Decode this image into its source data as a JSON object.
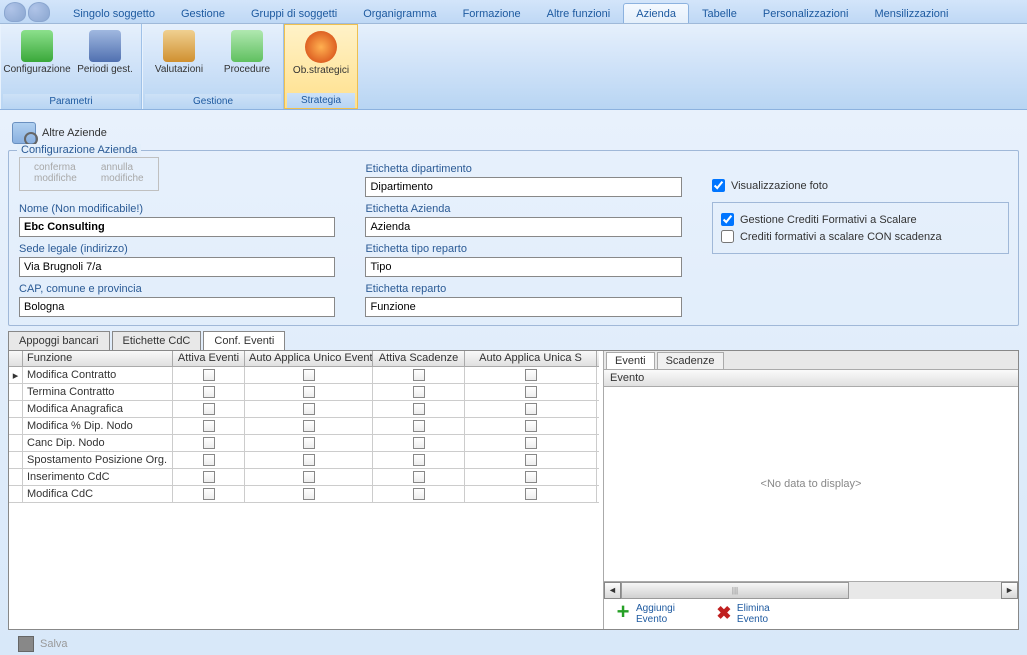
{
  "topTabs": {
    "items": [
      {
        "label": "Singolo soggetto"
      },
      {
        "label": "Gestione"
      },
      {
        "label": "Gruppi di soggetti"
      },
      {
        "label": "Organigramma"
      },
      {
        "label": "Formazione"
      },
      {
        "label": "Altre funzioni"
      },
      {
        "label": "Azienda",
        "active": true
      },
      {
        "label": "Tabelle"
      },
      {
        "label": "Personalizzazioni"
      },
      {
        "label": "Mensilizzazioni"
      }
    ]
  },
  "ribbon": {
    "groups": [
      {
        "label": "Parametri",
        "buttons": [
          {
            "label": "Configurazione",
            "iconColor": "linear-gradient(to bottom,#8ce08c,#3aa83a)",
            "name": "configurazione"
          },
          {
            "label": "Periodi gest.",
            "iconColor": "linear-gradient(to bottom,#a0b8e0,#5070b0)",
            "name": "periodi-gest"
          }
        ]
      },
      {
        "label": "Gestione",
        "buttons": [
          {
            "label": "Valutazioni",
            "iconColor": "linear-gradient(to bottom,#f0d090,#d09030)",
            "name": "valutazioni"
          },
          {
            "label": "Procedure",
            "iconColor": "linear-gradient(to bottom,#b0e8b0,#60c060)",
            "name": "procedure"
          }
        ]
      },
      {
        "label": "Strategia",
        "buttons": [
          {
            "label": "Ob.strategici",
            "iconColor": "radial-gradient(circle,#ffb050,#d04010)",
            "name": "ob-strategici",
            "active": true
          }
        ]
      }
    ]
  },
  "sectionHeader": "Altre Aziende",
  "config": {
    "legend": "Configurazione Azienda",
    "actions": {
      "confirm": "conferma\nmodifiche",
      "cancel": "annulla\nmodifiche"
    },
    "fields": {
      "nomeLabel": "Nome (Non modificabile!)",
      "nomeValue": "Ebc Consulting",
      "sedeLabel": "Sede legale (indirizzo)",
      "sedeValue": "Via Brugnoli 7/a",
      "capLabel": "CAP, comune e provincia",
      "capValue": "Bologna",
      "etDipLabel": "Etichetta dipartimento",
      "etDipValue": "Dipartimento",
      "etAzLabel": "Etichetta Azienda",
      "etAzValue": "Azienda",
      "etTipoLabel": "Etichetta tipo reparto",
      "etTipoValue": "Tipo",
      "etRepLabel": "Etichetta reparto",
      "etRepValue": "Funzione"
    },
    "checks": {
      "visFoto": "Visualizzazione foto",
      "gestCred": "Gestione Crediti Formativi a Scalare",
      "credScad": "Crediti formativi a scalare CON scadenza"
    }
  },
  "lowerTabs": [
    "Appoggi bancari",
    "Etichette CdC",
    "Conf. Eventi"
  ],
  "grid": {
    "headers": [
      "Funzione",
      "Attiva Eventi",
      "Auto Applica Unico Evento",
      "Attiva Scadenze",
      "Auto Applica Unica S"
    ],
    "rows": [
      {
        "label": "Modifica Contratto",
        "current": true
      },
      {
        "label": "Termina Contratto"
      },
      {
        "label": "Modifica Anagrafica"
      },
      {
        "label": "Modifica % Dip. Nodo"
      },
      {
        "label": "Canc Dip. Nodo"
      },
      {
        "label": "Spostamento Posizione Org."
      },
      {
        "label": "Inserimento CdC"
      },
      {
        "label": "Modifica CdC"
      }
    ]
  },
  "rightPanel": {
    "tabs": [
      "Eventi",
      "Scadenze"
    ],
    "header": "Evento",
    "empty": "<No data to display>",
    "actions": {
      "add": "Aggiungi\nEvento",
      "del": "Elimina\nEvento"
    }
  },
  "salva": "Salva"
}
